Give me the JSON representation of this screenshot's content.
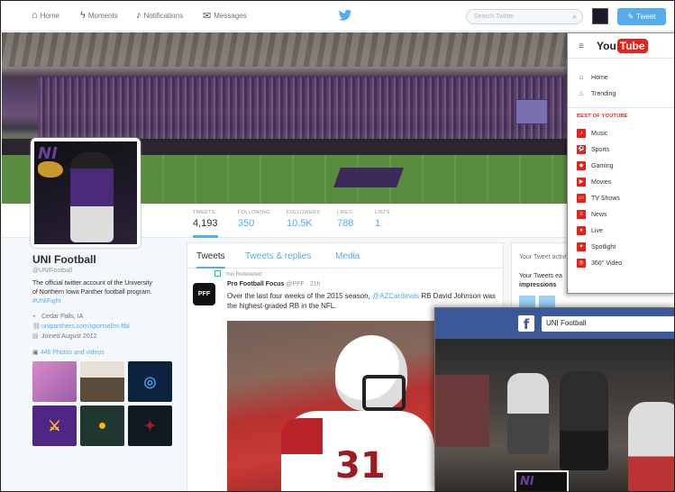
{
  "twitter": {
    "nav": {
      "home": "Home",
      "moments": "Moments",
      "notifications": "Notifications",
      "messages": "Messages",
      "search_placeholder": "Search Twitter",
      "tweet_button": "Tweet"
    },
    "stats": [
      {
        "label": "TWEETS",
        "value": "4,193"
      },
      {
        "label": "FOLLOWING",
        "value": "350"
      },
      {
        "label": "FOLLOWERS",
        "value": "10.5K"
      },
      {
        "label": "LIKES",
        "value": "788"
      },
      {
        "label": "LISTS",
        "value": "1"
      }
    ],
    "profile": {
      "name": "UNI Football",
      "handle": "@UNIFootball",
      "bio_text": "The official twitter account of the University of Northern Iowa Panther football program. ",
      "bio_tag": "#UNIFight",
      "location": "Cedar Falls, IA",
      "website": "unipanthers.com/sportsel/m-ftbl",
      "joined": "Joined August 2012",
      "photos_link": "446 Photos and videos"
    },
    "timeline": {
      "tabs": [
        "Tweets",
        "Tweets & replies",
        "Media"
      ],
      "retweeted_by": "You Retweeted",
      "tweet": {
        "avatar_text": "PFF",
        "author": "Pro Football Focus",
        "handle": "@PFF · 21h",
        "text_1": "Over the last four weeks of the 2015 season, ",
        "mention": "@AZCardinals",
        "text_2": " RB David Johnson was the highest-graded RB in the NFL."
      },
      "photo_number": "31"
    },
    "side_widget": {
      "title": "Your Tweet activity",
      "line1": "Your Tweets ea",
      "line2": "impressions"
    }
  },
  "youtube": {
    "logo_you": "You",
    "logo_tube": "Tube",
    "nav": [
      {
        "label": "Home",
        "icon": "home-icon"
      },
      {
        "label": "Trending",
        "icon": "flame-icon"
      }
    ],
    "section_title": "BEST OF YOUTUBE",
    "items": [
      {
        "label": "Music",
        "icon": "music-icon"
      },
      {
        "label": "Sports",
        "icon": "sports-icon"
      },
      {
        "label": "Gaming",
        "icon": "gaming-icon"
      },
      {
        "label": "Movies",
        "icon": "movies-icon"
      },
      {
        "label": "TV Shows",
        "icon": "tv-icon"
      },
      {
        "label": "News",
        "icon": "news-icon"
      },
      {
        "label": "Live",
        "icon": "live-icon"
      },
      {
        "label": "Spotlight",
        "icon": "spotlight-icon"
      },
      {
        "label": "360° Video",
        "icon": "360-icon"
      }
    ]
  },
  "facebook": {
    "search_value": "UNI Football",
    "logo": "f",
    "profile_text": "NI"
  },
  "profile_pic_text": "NI",
  "colors": {
    "twitter_blue": "#55acee",
    "youtube_red": "#e62117",
    "facebook_blue": "#3b5998",
    "uni_purple": "#4b2a7a"
  }
}
